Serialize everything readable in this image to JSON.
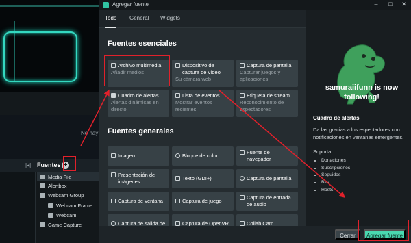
{
  "editor": {
    "no_sources_text": "No hay",
    "sources_panel": {
      "title": "Fuentes",
      "collapse_glyph": "|◂|",
      "add_glyph": "+",
      "items": [
        {
          "label": "Media File",
          "icon": "media-icon",
          "indent": 0,
          "selected": true
        },
        {
          "label": "Alertbox",
          "icon": "bell-icon",
          "indent": 0,
          "selected": false
        },
        {
          "label": "Webcam Group",
          "icon": "folder-icon",
          "indent": 0,
          "selected": false
        },
        {
          "label": "Webcam Frame",
          "icon": "image-icon",
          "indent": 1,
          "selected": false
        },
        {
          "label": "Webcam",
          "icon": "webcam-icon",
          "indent": 1,
          "selected": false
        },
        {
          "label": "Game Capture",
          "icon": "gamepad-icon",
          "indent": 0,
          "selected": false
        }
      ]
    }
  },
  "dialog": {
    "window_title": "Agregar fuente",
    "window_buttons": {
      "minimize": "–",
      "maximize": "□",
      "close": "✕"
    },
    "tabs": [
      {
        "label": "Todo",
        "active": true
      },
      {
        "label": "General",
        "active": false
      },
      {
        "label": "Widgets",
        "active": false
      }
    ],
    "essential": {
      "title": "Fuentes esenciales",
      "cards": [
        {
          "name": "Archivo multimedia",
          "desc": "Añadir medios",
          "icon": "media-icon"
        },
        {
          "name": "Dispositivo de captura de vídeo",
          "desc": "Su cámara web",
          "icon": "camera-icon"
        },
        {
          "name": "Captura de pantalla",
          "desc": "Capturar juegos y aplicaciones",
          "icon": "screen-icon"
        },
        {
          "name": "Cuadro de alertas",
          "desc": "Alertas dinámicas en directo",
          "icon": "bell-icon"
        },
        {
          "name": "Lista de eventos",
          "desc": "Mostrar eventos recientes",
          "icon": "list-icon"
        },
        {
          "name": "Etiqueta de stream",
          "desc": "Reconocimiento de espectadores",
          "icon": "label-icon"
        }
      ]
    },
    "general": {
      "title": "Fuentes generales",
      "cards": [
        {
          "name": "Imagen",
          "icon": "image-icon"
        },
        {
          "name": "Bloque de color",
          "icon": "paint-icon"
        },
        {
          "name": "Fuente de navegador",
          "icon": "globe-icon"
        },
        {
          "name": "Presentación de imágenes",
          "icon": "slideshow-icon"
        },
        {
          "name": "Texto (GDI+)",
          "icon": "text-icon"
        },
        {
          "name": "Captura de pantalla",
          "icon": "monitor-icon"
        },
        {
          "name": "Captura de ventana",
          "icon": "window-icon"
        },
        {
          "name": "Captura de juego",
          "icon": "gamepad-icon"
        },
        {
          "name": "Captura de entrada de audio",
          "icon": "mic-icon"
        },
        {
          "name": "Captura de salida de",
          "icon": "speaker-icon"
        },
        {
          "name": "Captura de OpenVR",
          "icon": "vr-icon"
        },
        {
          "name": "Collab Cam",
          "icon": "collab-icon"
        }
      ]
    },
    "info": {
      "banner": "samuraiifunn is now following!",
      "title": "Cuadro de alertas",
      "description": "Da las gracias a los espectadores con notificaciones en ventanas emergentes.",
      "supports_label": "Soporta:",
      "supports": [
        "Donaciones",
        "Suscripciones",
        "Seguidos",
        "Bits",
        "Hosts"
      ]
    },
    "buttons": {
      "cancel": "Cerrar",
      "add": "Agregar fuente"
    }
  },
  "colors": {
    "accent": "#49d8b0",
    "annotation": "#e0212b",
    "dino": "#3fa05c"
  }
}
